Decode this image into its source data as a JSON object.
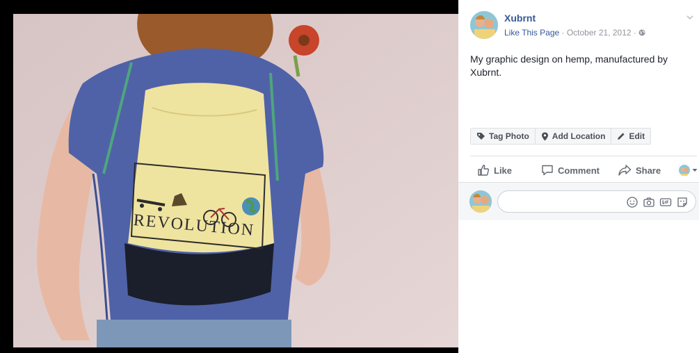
{
  "post": {
    "page_name": "Xubrnt",
    "like_link": "Like This Page",
    "separator": " · ",
    "date": "October 21, 2012",
    "separator2": " · ",
    "caption": "My graphic design on hemp, manufactured by Xubrnt."
  },
  "photo": {
    "print_text": "REVOLUTION"
  },
  "photo_actions": {
    "tag_label": "Tag Photo",
    "location_label": "Add Location",
    "edit_label": "Edit"
  },
  "reactions": {
    "like_label": "Like",
    "comment_label": "Comment",
    "share_label": "Share"
  },
  "comment_box": {
    "placeholder": ""
  },
  "colors": {
    "link": "#365899",
    "meta": "#90949c",
    "border": "#dddfe2",
    "shirt": "#4f62a8",
    "bag": "#efe3a0"
  }
}
